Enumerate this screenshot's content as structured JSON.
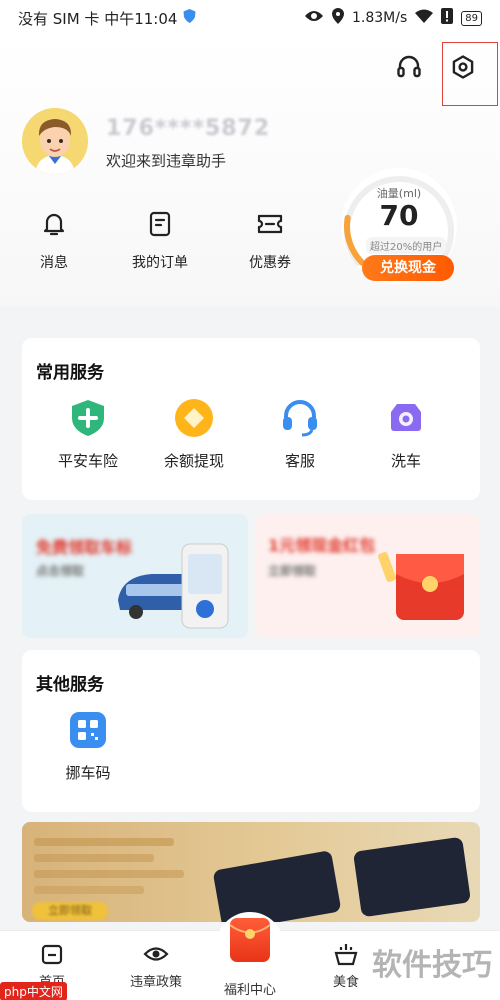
{
  "status_bar": {
    "carrier_time": "没有 SIM 卡 中午11:04",
    "net_speed": "1.83M/s",
    "battery": "89"
  },
  "profile": {
    "masked_phone": "176****5872",
    "welcome": "欢迎来到违章助手"
  },
  "gauge": {
    "label": "油量(ml)",
    "value": "70",
    "subtext": "超过20%的用户",
    "button": "兑换现金",
    "level_fraction": 0.2
  },
  "quick_actions": [
    {
      "label": "消息",
      "icon": "bell-icon"
    },
    {
      "label": "我的订单",
      "icon": "order-icon"
    },
    {
      "label": "优惠券",
      "icon": "coupon-icon"
    }
  ],
  "common_services": {
    "title": "常用服务",
    "items": [
      {
        "label": "平安车险",
        "icon": "shield-plus-icon"
      },
      {
        "label": "余额提现",
        "icon": "coin-icon"
      },
      {
        "label": "客服",
        "icon": "headset-icon"
      },
      {
        "label": "洗车",
        "icon": "car-wash-icon"
      }
    ]
  },
  "banners": [
    {
      "title": "免费领取车标",
      "sub": "点击领取"
    },
    {
      "title": "1元领现金红包",
      "sub": "立即领取"
    }
  ],
  "other_services": {
    "title": "其他服务",
    "items": [
      {
        "label": "挪车码",
        "icon": "qr-code-icon"
      }
    ]
  },
  "promo": {
    "button": "立即领取"
  },
  "tabs": [
    {
      "label": "首页",
      "icon": "home-icon"
    },
    {
      "label": "违章政策",
      "icon": "eye-icon"
    },
    {
      "label": "福利中心",
      "icon": "red-packet-icon"
    },
    {
      "label": "美食",
      "icon": "food-icon"
    }
  ],
  "watermark": {
    "text": "软件技巧",
    "logo": "php中文网"
  },
  "colors": {
    "accent_orange": "#ff6a00",
    "gauge_track": "#eeeeee",
    "gauge_fill": "#f7a23b",
    "settings_outline": "#e0413b"
  }
}
